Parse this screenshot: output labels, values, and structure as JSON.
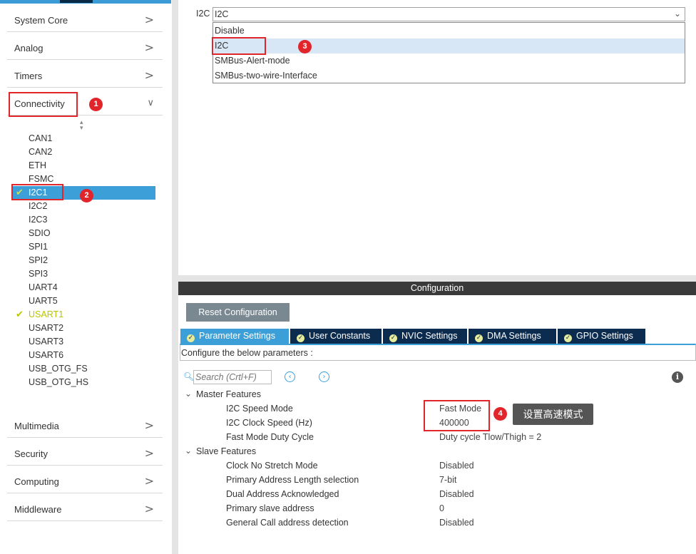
{
  "sidebar": {
    "categories_top": [
      "System Core",
      "Analog",
      "Timers",
      "Connectivity"
    ],
    "categories_bottom": [
      "Multimedia",
      "Security",
      "Computing",
      "Middleware"
    ],
    "peripherals": [
      "CAN1",
      "CAN2",
      "ETH",
      "FSMC",
      "I2C1",
      "I2C2",
      "I2C3",
      "SDIO",
      "SPI1",
      "SPI2",
      "SPI3",
      "UART4",
      "UART5",
      "USART1",
      "USART2",
      "USART3",
      "USART6",
      "USB_OTG_FS",
      "USB_OTG_HS"
    ],
    "selected": "I2C1",
    "enabled": [
      "I2C1",
      "USART1"
    ],
    "chevron_right": ">",
    "chevron_down": "∨",
    "sort_icon": "sort-arrows-icon"
  },
  "mode": {
    "label": "I2C",
    "value": "I2C",
    "options": [
      "Disable",
      "I2C",
      "SMBus-Alert-mode",
      "SMBus-two-wire-Interface"
    ],
    "highlighted_option": "I2C"
  },
  "configuration": {
    "header": "Configuration",
    "reset_button": "Reset Configuration",
    "tabs": [
      "Parameter Settings",
      "User Constants",
      "NVIC Settings",
      "DMA Settings",
      "GPIO Settings"
    ],
    "active_tab": "Parameter Settings",
    "instructions": "Configure the below parameters :",
    "search_placeholder": "Search (Crtl+F)",
    "groups": [
      {
        "name": "Master Features",
        "params": [
          {
            "name": "I2C Speed Mode",
            "value": "Fast Mode"
          },
          {
            "name": "I2C Clock Speed (Hz)",
            "value": "400000"
          },
          {
            "name": "Fast Mode Duty Cycle",
            "value": "Duty cycle Tlow/Thigh = 2"
          }
        ]
      },
      {
        "name": "Slave Features",
        "params": [
          {
            "name": "Clock No Stretch Mode",
            "value": "Disabled"
          },
          {
            "name": "Primary Address Length selection",
            "value": "7-bit"
          },
          {
            "name": "Dual Address Acknowledged",
            "value": "Disabled"
          },
          {
            "name": "Primary slave address",
            "value": "0"
          },
          {
            "name": "General Call address detection",
            "value": "Disabled"
          }
        ]
      }
    ]
  },
  "annotations": {
    "badges": [
      "1",
      "2",
      "3",
      "4"
    ],
    "tooltip": "设置高速模式"
  },
  "colors": {
    "selection_blue": "#3c9fd7",
    "tab_navy": "#0b2b4f",
    "annotation_red": "#e0252b",
    "enabled_green": "#b9c500"
  }
}
